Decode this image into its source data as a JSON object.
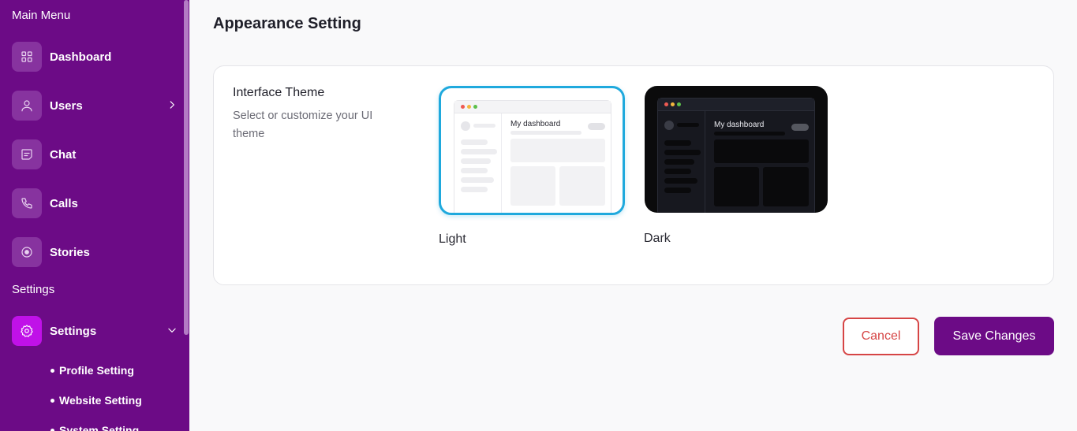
{
  "sidebar": {
    "main_menu_title": "Main Menu",
    "items": [
      {
        "label": "Dashboard",
        "icon": "grid-icon"
      },
      {
        "label": "Users",
        "icon": "user-icon"
      },
      {
        "label": "Chat",
        "icon": "chat-icon"
      },
      {
        "label": "Calls",
        "icon": "phone-icon"
      },
      {
        "label": "Stories",
        "icon": "stories-icon"
      }
    ],
    "settings_title": "Settings",
    "settings_item": {
      "label": "Settings",
      "icon": "gear-icon"
    },
    "sub_items": [
      {
        "label": "Profile Setting"
      },
      {
        "label": "Website Setting"
      },
      {
        "label": "System Setting"
      }
    ]
  },
  "page": {
    "title": "Appearance Setting"
  },
  "theme": {
    "heading": "Interface Theme",
    "description": "Select or customize your UI theme",
    "options": [
      {
        "label": "Light",
        "preview_title": "My dashboard",
        "selected": true
      },
      {
        "label": "Dark",
        "preview_title": "My dashboard",
        "selected": false
      }
    ]
  },
  "actions": {
    "cancel_label": "Cancel",
    "save_label": "Save Changes"
  },
  "colors": {
    "sidebar_bg": "#6c0b86",
    "accent": "#c011e8",
    "selected_border": "#1fa9dd",
    "cancel": "#d64545",
    "traffic_red": "#ee5a52",
    "traffic_yellow": "#f4b73d",
    "traffic_green": "#5cc04b"
  }
}
